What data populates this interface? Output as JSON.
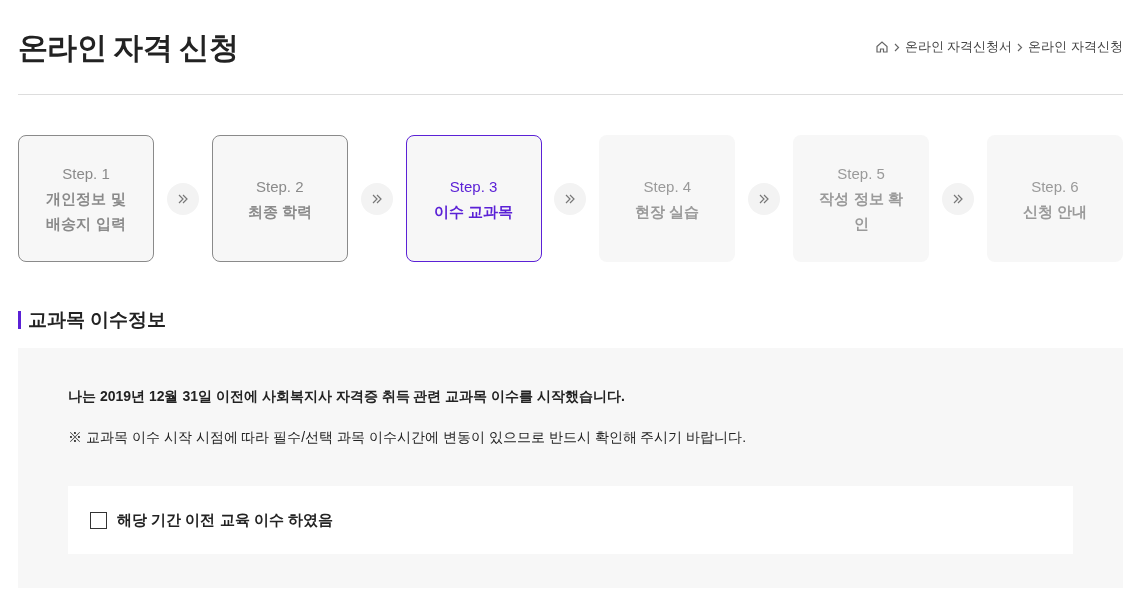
{
  "page_title": "온라인 자격 신청",
  "breadcrumb": [
    "온라인 자격신청서",
    "온라인 자격신청"
  ],
  "steps": [
    {
      "step": "Step. 1",
      "lines": [
        "개인정보 및",
        "배송지 입력"
      ],
      "completed": true,
      "selected": false
    },
    {
      "step": "Step. 2",
      "lines": [
        "최종 학력"
      ],
      "completed": true,
      "selected": false
    },
    {
      "step": "Step. 3",
      "lines": [
        "이수 교과목"
      ],
      "completed": false,
      "selected": true
    },
    {
      "step": "Step. 4",
      "lines": [
        "현장 실습"
      ],
      "completed": false,
      "selected": false
    },
    {
      "step": "Step. 5",
      "lines": [
        "작성 정보 확",
        "인"
      ],
      "completed": false,
      "selected": false
    },
    {
      "step": "Step. 6",
      "lines": [
        "신청 안내"
      ],
      "completed": false,
      "selected": false
    }
  ],
  "section_title": "교과목 이수정보",
  "statement": "나는 2019년 12월 31일 이전에 사회복지사 자격증 취득 관련 교과목 이수를 시작했습니다.",
  "notice": "※ 교과목 이수 시작 시점에 따라 필수/선택 과목 이수시간에 변동이 있으므로 반드시 확인해 주시기 바랍니다.",
  "checkbox": {
    "label": "해당 기간 이전 교육 이수 하였음",
    "checked": false
  }
}
